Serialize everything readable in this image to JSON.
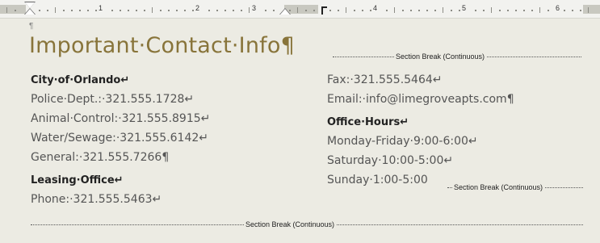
{
  "ruler": {
    "numbers": [
      "1",
      "2",
      "3",
      "4",
      "5",
      "6"
    ]
  },
  "document": {
    "pilcrow": "¶",
    "title": "Important·Contact·Info¶",
    "section_break_label": "Section Break (Continuous)",
    "left_column": [
      {
        "kind": "head",
        "text": "City·of·Orlando↵"
      },
      {
        "kind": "line",
        "text": "Police·Dept.:·321.555.1728↵"
      },
      {
        "kind": "line",
        "text": "Animal·Control:·321.555.8915↵"
      },
      {
        "kind": "line",
        "text": "Water/Sewage:·321.555.6142↵"
      },
      {
        "kind": "line",
        "text": "General:·321.555.7266¶"
      },
      {
        "kind": "head",
        "text": "Leasing·Office↵"
      },
      {
        "kind": "line",
        "text": "Phone:·321.555.5463↵"
      }
    ],
    "right_column": [
      {
        "kind": "line",
        "text": "Fax:·321.555.5464↵"
      },
      {
        "kind": "line",
        "text": "Email:·info@limegroveapts.com¶"
      },
      {
        "kind": "head",
        "text": "Office·Hours↵"
      },
      {
        "kind": "line",
        "text": "Monday-Friday·9:00-6:00↵"
      },
      {
        "kind": "line",
        "text": "Saturday·10:00-5:00↵"
      },
      {
        "kind": "line",
        "text": "Sunday·1:00-5:00"
      }
    ]
  }
}
